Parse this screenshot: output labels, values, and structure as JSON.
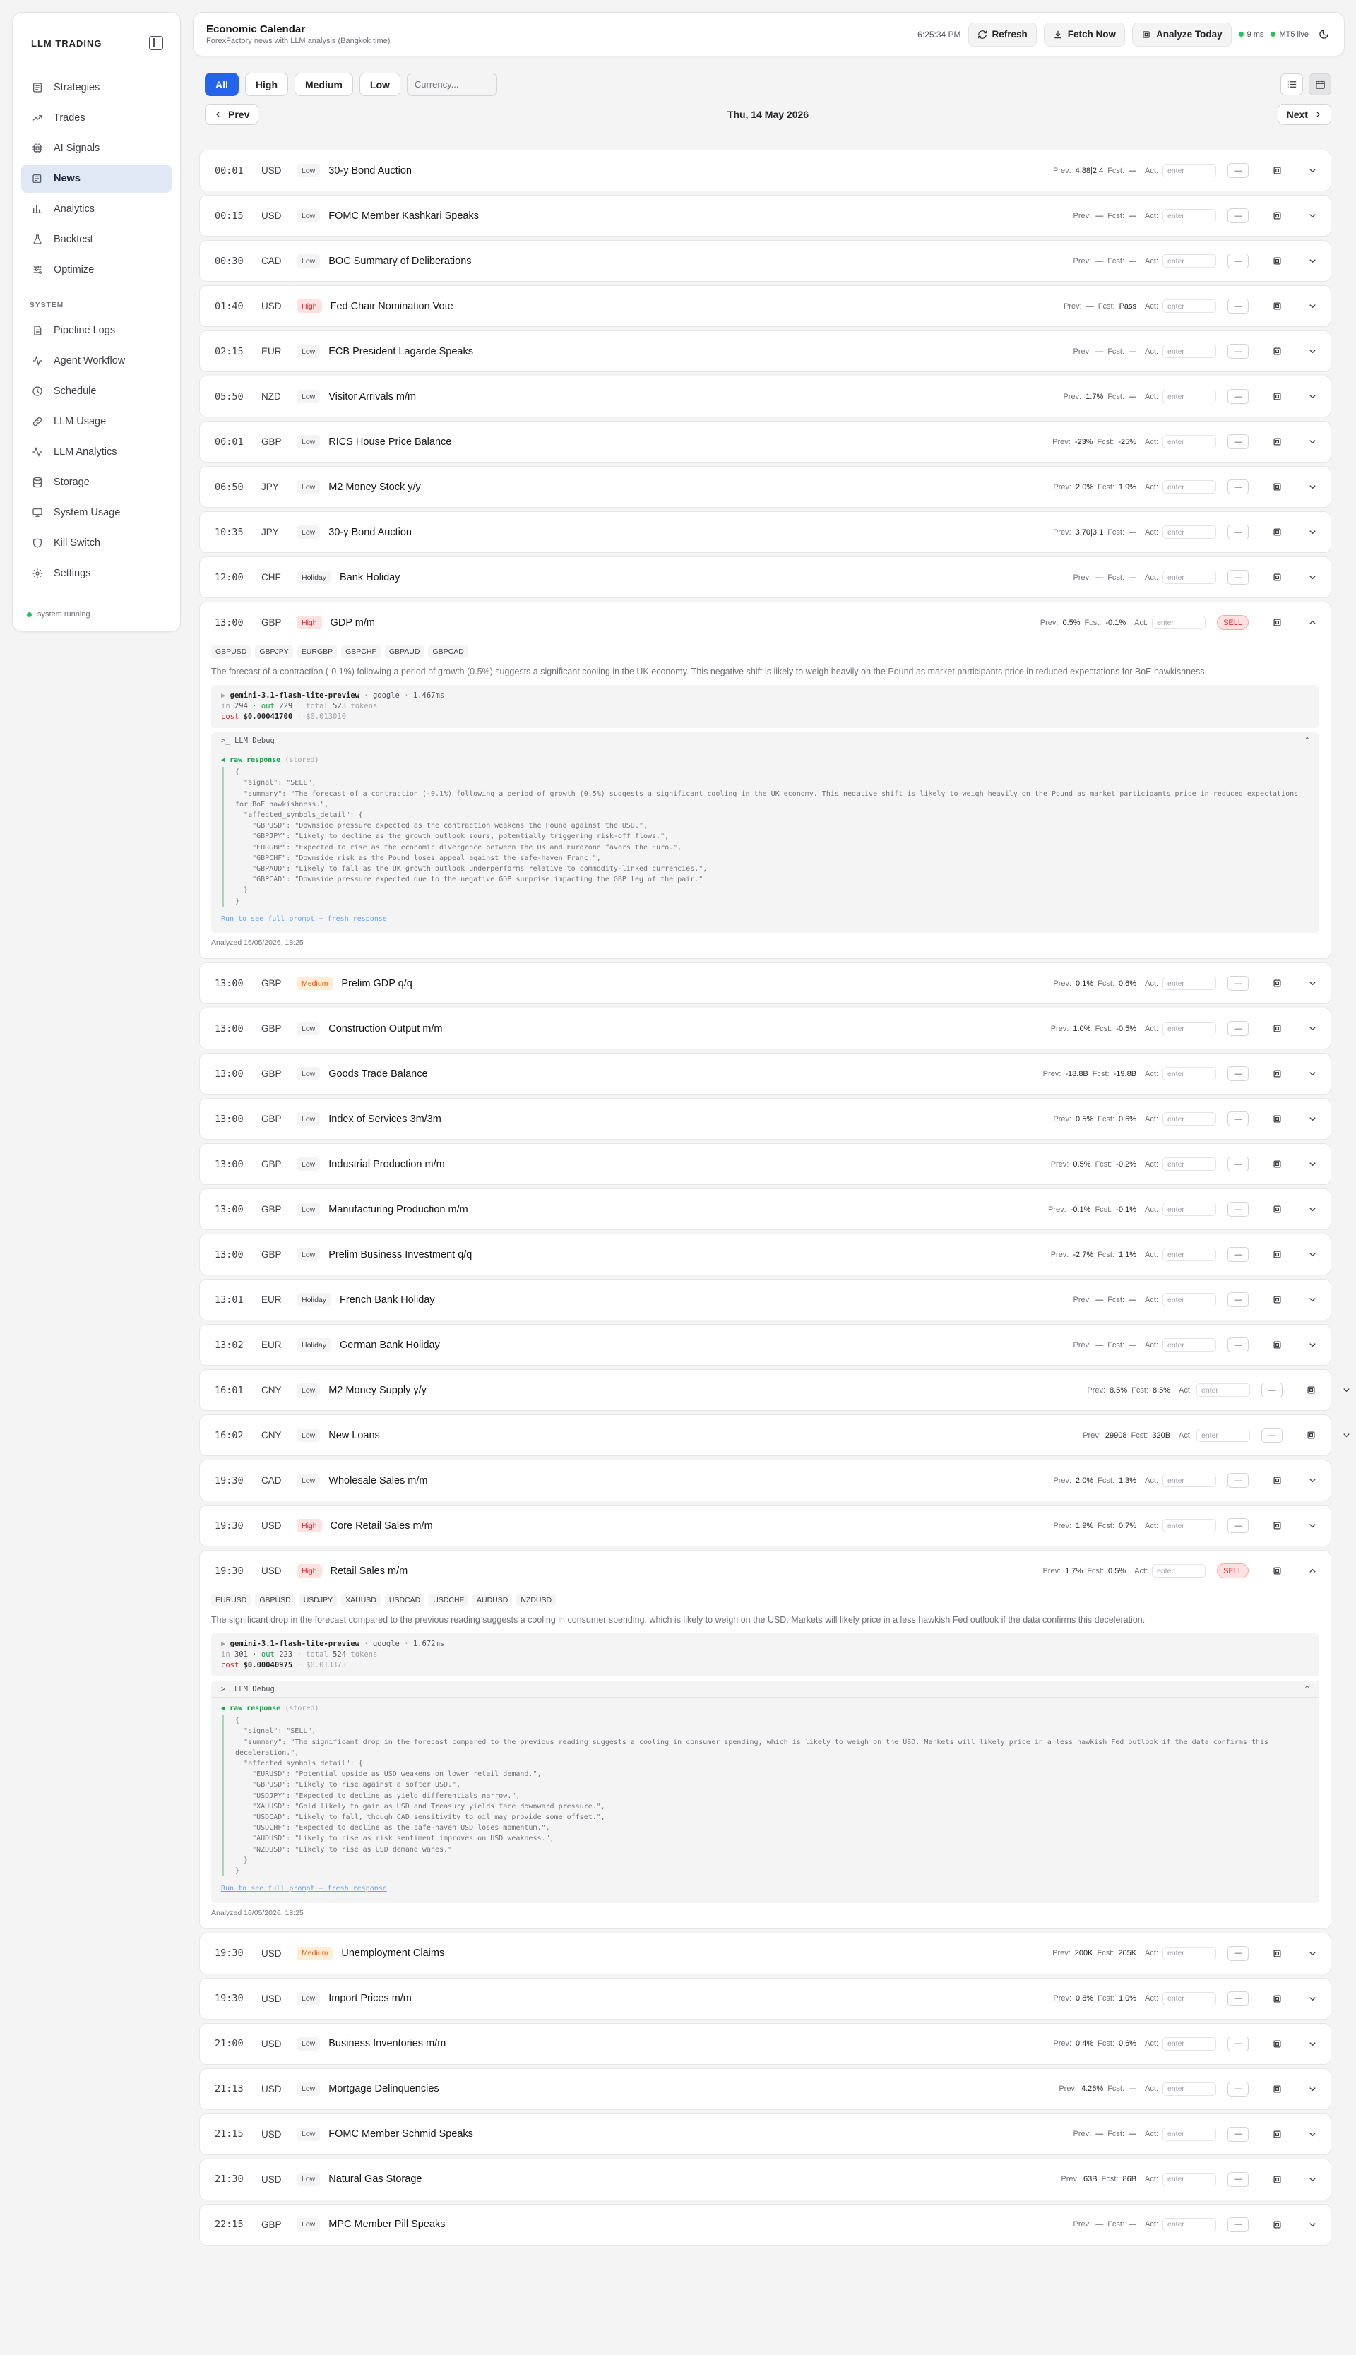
{
  "app": {
    "brand": "LLM TRADING",
    "system_status": "system running"
  },
  "sidebar": {
    "items": [
      {
        "label": "Strategies",
        "icon": "strategies-icon",
        "active": false
      },
      {
        "label": "Trades",
        "icon": "trades-icon",
        "active": false
      },
      {
        "label": "AI Signals",
        "icon": "ai-signals-icon",
        "active": false
      },
      {
        "label": "News",
        "icon": "news-icon",
        "active": true
      },
      {
        "label": "Analytics",
        "icon": "analytics-icon",
        "active": false
      },
      {
        "label": "Backtest",
        "icon": "backtest-icon",
        "active": false
      },
      {
        "label": "Optimize",
        "icon": "optimize-icon",
        "active": false
      }
    ],
    "section_label": "SYSTEM",
    "system_items": [
      {
        "label": "Pipeline Logs",
        "icon": "pipeline-logs-icon"
      },
      {
        "label": "Agent Workflow",
        "icon": "agent-workflow-icon"
      },
      {
        "label": "Schedule",
        "icon": "schedule-icon"
      },
      {
        "label": "LLM Usage",
        "icon": "llm-usage-icon"
      },
      {
        "label": "LLM Analytics",
        "icon": "llm-analytics-icon"
      },
      {
        "label": "Storage",
        "icon": "storage-icon"
      },
      {
        "label": "System Usage",
        "icon": "system-usage-icon"
      },
      {
        "label": "Kill Switch",
        "icon": "kill-switch-icon"
      },
      {
        "label": "Settings",
        "icon": "settings-icon"
      }
    ]
  },
  "header": {
    "title": "Economic Calendar",
    "subtitle": "ForexFactory news with LLM analysis (Bangkok time)",
    "clock": "6:25:34 PM",
    "refresh_label": "Refresh",
    "fetch_label": "Fetch Now",
    "analyze_label": "Analyze Today",
    "latency": "9 ms",
    "mt5": "MT5 live"
  },
  "filters": {
    "chips": [
      "All",
      "High",
      "Medium",
      "Low"
    ],
    "active": "All",
    "currency_placeholder": "Currency..."
  },
  "nav": {
    "prev_label": "Prev",
    "next_label": "Next",
    "date": "Thu, 14 May 2026"
  },
  "labels": {
    "prev": "Prev:",
    "fcst": "Fcst:",
    "act": "Act:",
    "act_placeholder": "enter"
  },
  "colors": {
    "accent": "#2563eb",
    "high": "#dc2626",
    "medium": "#ea580c",
    "ok": "#22c55e"
  },
  "events": [
    {
      "time": "00:01",
      "currency": "USD",
      "impact": "Low",
      "title": "30-y Bond Auction",
      "prev": "4.88|2.4",
      "fcst": "—"
    },
    {
      "time": "00:15",
      "currency": "USD",
      "impact": "Low",
      "title": "FOMC Member Kashkari Speaks",
      "prev": "—",
      "fcst": "—"
    },
    {
      "time": "00:30",
      "currency": "CAD",
      "impact": "Low",
      "title": "BOC Summary of Deliberations",
      "prev": "—",
      "fcst": "—"
    },
    {
      "time": "01:40",
      "currency": "USD",
      "impact": "High",
      "title": "Fed Chair Nomination Vote",
      "prev": "—",
      "fcst": "Pass"
    },
    {
      "time": "02:15",
      "currency": "EUR",
      "impact": "Low",
      "title": "ECB President Lagarde Speaks",
      "prev": "—",
      "fcst": "—"
    },
    {
      "time": "05:50",
      "currency": "NZD",
      "impact": "Low",
      "title": "Visitor Arrivals m/m",
      "prev": "1.7%",
      "fcst": "—"
    },
    {
      "time": "06:01",
      "currency": "GBP",
      "impact": "Low",
      "title": "RICS House Price Balance",
      "prev": "-23%",
      "fcst": "-25%"
    },
    {
      "time": "06:50",
      "currency": "JPY",
      "impact": "Low",
      "title": "M2 Money Stock y/y",
      "prev": "2.0%",
      "fcst": "1.9%"
    },
    {
      "time": "10:35",
      "currency": "JPY",
      "impact": "Low",
      "title": "30-y Bond Auction",
      "prev": "3.70|3.1",
      "fcst": "—"
    },
    {
      "time": "12:00",
      "currency": "CHF",
      "impact": "Holiday",
      "title": "Bank Holiday",
      "prev": "—",
      "fcst": "—"
    },
    {
      "time": "13:00",
      "currency": "GBP",
      "impact": "High",
      "title": "GDP m/m",
      "prev": "0.5%",
      "fcst": "-0.1%",
      "signal": "SELL",
      "expanded": true,
      "symbols": [
        "GBPUSD",
        "GBPJPY",
        "EURGBP",
        "GBPCHF",
        "GBPAUD",
        "GBPCAD"
      ],
      "summary": "The forecast of a contraction (-0.1%) following a period of growth (0.5%) suggests a significant cooling in the UK economy. This negative shift is likely to weigh heavily on the Pound as market participants price in reduced expectations for BoE hawkishness.",
      "model": "gemini-3.1-flash-lite-preview",
      "provider": "google",
      "latency": "1.467ms",
      "tok_in": "294",
      "tok_out": "229",
      "tok_total": "523",
      "cost": "$0.00041700",
      "cost_alt": "$0.013010",
      "debug_label": "LLM Debug",
      "raw_label": "raw response",
      "raw_note": "(stored)",
      "raw_json": "{\n  \"signal\": \"SELL\",\n  \"summary\": \"The forecast of a contraction (-0.1%) following a period of growth (0.5%) suggests a significant cooling in the UK economy. This negative shift is likely to weigh heavily on the Pound as market participants price in reduced expectations for BoE hawkishness.\",\n  \"affected_symbols_detail\": {\n    \"GBPUSD\": \"Downside pressure expected as the contraction weakens the Pound against the USD.\",\n    \"GBPJPY\": \"Likely to decline as the growth outlook sours, potentially triggering risk-off flows.\",\n    \"EURGBP\": \"Expected to rise as the economic divergence between the UK and Eurozone favors the Euro.\",\n    \"GBPCHF\": \"Downside risk as the Pound loses appeal against the safe-haven Franc.\",\n    \"GBPAUD\": \"Likely to fall as the UK growth outlook underperforms relative to commodity-linked currencies.\",\n    \"GBPCAD\": \"Downside pressure expected due to the negative GDP surprise impacting the GBP leg of the pair.\"\n  }\n}",
      "run_link": "Run to see full prompt + fresh response",
      "analyzed": "Analyzed 16/05/2026, 18:25"
    },
    {
      "time": "13:00",
      "currency": "GBP",
      "impact": "Medium",
      "title": "Prelim GDP q/q",
      "prev": "0.1%",
      "fcst": "0.6%"
    },
    {
      "time": "13:00",
      "currency": "GBP",
      "impact": "Low",
      "title": "Construction Output m/m",
      "prev": "1.0%",
      "fcst": "-0.5%"
    },
    {
      "time": "13:00",
      "currency": "GBP",
      "impact": "Low",
      "title": "Goods Trade Balance",
      "prev": "-18.8B",
      "fcst": "-19.8B"
    },
    {
      "time": "13:00",
      "currency": "GBP",
      "impact": "Low",
      "title": "Index of Services 3m/3m",
      "prev": "0.5%",
      "fcst": "0.6%"
    },
    {
      "time": "13:00",
      "currency": "GBP",
      "impact": "Low",
      "title": "Industrial Production m/m",
      "prev": "0.5%",
      "fcst": "-0.2%"
    },
    {
      "time": "13:00",
      "currency": "GBP",
      "impact": "Low",
      "title": "Manufacturing Production m/m",
      "prev": "-0.1%",
      "fcst": "-0.1%"
    },
    {
      "time": "13:00",
      "currency": "GBP",
      "impact": "Low",
      "title": "Prelim Business Investment q/q",
      "prev": "-2.7%",
      "fcst": "1.1%"
    },
    {
      "time": "13:01",
      "currency": "EUR",
      "impact": "Holiday",
      "title": "French Bank Holiday",
      "prev": "—",
      "fcst": "—"
    },
    {
      "time": "13:02",
      "currency": "EUR",
      "impact": "Holiday",
      "title": "German Bank Holiday",
      "prev": "—",
      "fcst": "—"
    },
    {
      "time": "16:01",
      "currency": "CNY",
      "impact": "Low",
      "title": "M2 Money Supply y/y",
      "prev": "8.5%",
      "fcst": "8.5%",
      "wide": true
    },
    {
      "time": "16:02",
      "currency": "CNY",
      "impact": "Low",
      "title": "New Loans",
      "prev": "29908",
      "fcst": "320B",
      "wide": true
    },
    {
      "time": "19:30",
      "currency": "CAD",
      "impact": "Low",
      "title": "Wholesale Sales m/m",
      "prev": "2.0%",
      "fcst": "1.3%"
    },
    {
      "time": "19:30",
      "currency": "USD",
      "impact": "High",
      "title": "Core Retail Sales m/m",
      "prev": "1.9%",
      "fcst": "0.7%"
    },
    {
      "time": "19:30",
      "currency": "USD",
      "impact": "High",
      "title": "Retail Sales m/m",
      "prev": "1.7%",
      "fcst": "0.5%",
      "signal": "SELL",
      "expanded": true,
      "symbols": [
        "EURUSD",
        "GBPUSD",
        "USDJPY",
        "XAUUSD",
        "USDCAD",
        "USDCHF",
        "AUDUSD",
        "NZDUSD"
      ],
      "summary": "The significant drop in the forecast compared to the previous reading suggests a cooling in consumer spending, which is likely to weigh on the USD. Markets will likely price in a less hawkish Fed outlook if the data confirms this deceleration.",
      "model": "gemini-3.1-flash-lite-preview",
      "provider": "google",
      "latency": "1.672ms",
      "tok_in": "301",
      "tok_out": "223",
      "tok_total": "524",
      "cost": "$0.00040975",
      "cost_alt": "$0.013373",
      "debug_label": "LLM Debug",
      "raw_label": "raw response",
      "raw_note": "(stored)",
      "raw_json": "{\n  \"signal\": \"SELL\",\n  \"summary\": \"The significant drop in the forecast compared to the previous reading suggests a cooling in consumer spending, which is likely to weigh on the USD. Markets will likely price in a less hawkish Fed outlook if the data confirms this deceleration.\",\n  \"affected_symbols_detail\": {\n    \"EURUSD\": \"Potential upside as USD weakens on lower retail demand.\",\n    \"GBPUSD\": \"Likely to rise against a softer USD.\",\n    \"USDJPY\": \"Expected to decline as yield differentials narrow.\",\n    \"XAUUSD\": \"Gold likely to gain as USD and Treasury yields face downward pressure.\",\n    \"USDCAD\": \"Likely to fall, though CAD sensitivity to oil may provide some offset.\",\n    \"USDCHF\": \"Expected to decline as the safe-haven USD loses momentum.\",\n    \"AUDUSD\": \"Likely to rise as risk sentiment improves on USD weakness.\",\n    \"NZDUSD\": \"Likely to rise as USD demand wanes.\"\n  }\n}",
      "run_link": "Run to see full prompt + fresh response",
      "analyzed": "Analyzed 16/05/2026, 18:25"
    },
    {
      "time": "19:30",
      "currency": "USD",
      "impact": "Medium",
      "title": "Unemployment Claims",
      "prev": "200K",
      "fcst": "205K"
    },
    {
      "time": "19:30",
      "currency": "USD",
      "impact": "Low",
      "title": "Import Prices m/m",
      "prev": "0.8%",
      "fcst": "1.0%"
    },
    {
      "time": "21:00",
      "currency": "USD",
      "impact": "Low",
      "title": "Business Inventories m/m",
      "prev": "0.4%",
      "fcst": "0.6%"
    },
    {
      "time": "21:13",
      "currency": "USD",
      "impact": "Low",
      "title": "Mortgage Delinquencies",
      "prev": "4.26%",
      "fcst": "—"
    },
    {
      "time": "21:15",
      "currency": "USD",
      "impact": "Low",
      "title": "FOMC Member Schmid Speaks",
      "prev": "—",
      "fcst": "—"
    },
    {
      "time": "21:30",
      "currency": "USD",
      "impact": "Low",
      "title": "Natural Gas Storage",
      "prev": "63B",
      "fcst": "86B"
    },
    {
      "time": "22:15",
      "currency": "GBP",
      "impact": "Low",
      "title": "MPC Member Pill Speaks",
      "prev": "—",
      "fcst": "—"
    }
  ]
}
